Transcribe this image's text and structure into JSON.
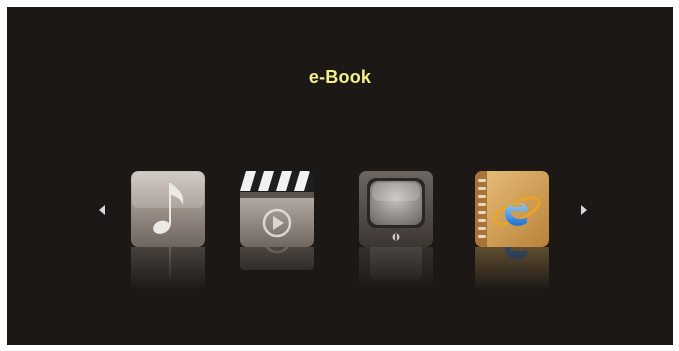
{
  "menu": {
    "title": "e-Book",
    "items": [
      {
        "icon": "music-note-icon"
      },
      {
        "icon": "clapperboard-icon"
      },
      {
        "icon": "tv-icon"
      },
      {
        "icon": "ebook-icon"
      }
    ],
    "selected_index": 3
  },
  "nav": {
    "left_icon": "chevron-left-icon",
    "right_icon": "chevron-right-icon"
  },
  "colors": {
    "background": "#1b1816",
    "title": "#f6f08a",
    "frame": "#ffffff"
  }
}
